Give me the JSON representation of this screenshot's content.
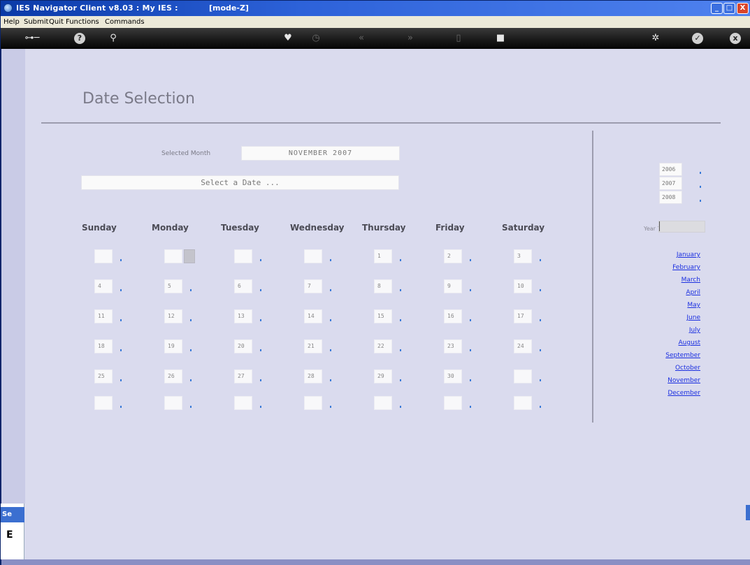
{
  "window": {
    "title": "IES Navigator Client v8.03 : My IES :",
    "mode": "[mode-Z]",
    "controls": {
      "minimize": "_",
      "maximize": "□",
      "close": "X"
    }
  },
  "menu": [
    "Help",
    "Submit",
    "Quit",
    "Functions",
    "Commands"
  ],
  "toolbar": {
    "icons": [
      "key-icon",
      "help-icon",
      "search-icon",
      "heart-icon",
      "clock-icon",
      "rewind-icon",
      "forward-icon",
      "restore-icon",
      "stop-icon",
      "settings-icon",
      "ok-icon",
      "cancel-icon"
    ],
    "labels": {
      "help": "?",
      "ok": "✓",
      "cancel": "x"
    }
  },
  "page": {
    "heading": "Date Selection",
    "selected_month_label": "Selected Month",
    "selected_month_value": "NOVEMBER 2007",
    "select_date_value": "Select a Date ..."
  },
  "calendar": {
    "day_headers": [
      "Sunday",
      "Monday",
      "Tuesday",
      "Wednesday",
      "Thursday",
      "Friday",
      "Saturday"
    ],
    "weeks": [
      [
        "",
        "",
        "",
        "",
        "1",
        "2",
        "3"
      ],
      [
        "4",
        "5",
        "6",
        "7",
        "8",
        "9",
        "10"
      ],
      [
        "11",
        "12",
        "13",
        "14",
        "15",
        "16",
        "17"
      ],
      [
        "18",
        "19",
        "20",
        "21",
        "22",
        "23",
        "24"
      ],
      [
        "25",
        "26",
        "27",
        "28",
        "29",
        "30",
        ""
      ],
      [
        "",
        "",
        "",
        "",
        "",
        "",
        ""
      ]
    ]
  },
  "year_panel": {
    "years": [
      "2006",
      "2007",
      "2008"
    ],
    "year_prompt": "Year ?",
    "year_input_value": "",
    "months": [
      "January",
      "February",
      "March",
      "April",
      "May",
      "June",
      "July",
      "August",
      "September",
      "October",
      "November",
      "December"
    ]
  },
  "side_tab": {
    "label": "Se",
    "char": "E"
  },
  "colors": {
    "title_bar": "#2d62d9",
    "content_bg": "#dadbee",
    "link": "#1b2fe0",
    "toolbar": "#1a1a1a"
  }
}
